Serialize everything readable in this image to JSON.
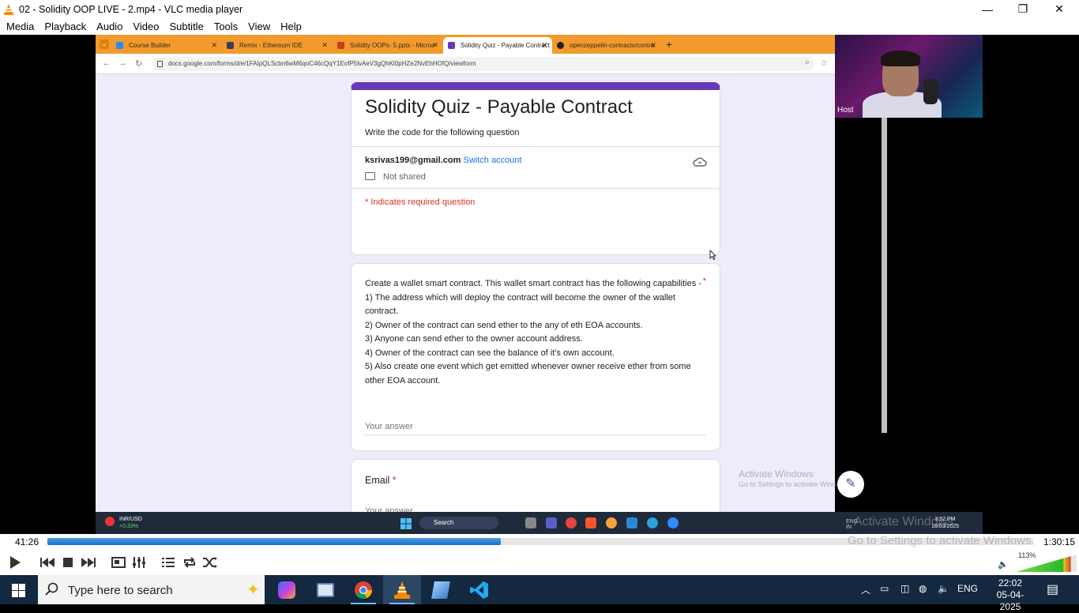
{
  "window": {
    "title": "02 - Solidity OOP LIVE - 2.mp4 - VLC media player",
    "controls": [
      "—",
      "❐",
      "✕"
    ]
  },
  "menu": [
    "Media",
    "Playback",
    "Audio",
    "Video",
    "Subtitle",
    "Tools",
    "View",
    "Help"
  ],
  "browser": {
    "tabs": [
      {
        "label": "Course Builder",
        "color": "#2a8af6"
      },
      {
        "label": "Remix - Ethereum IDE",
        "color": "#3c3c5a"
      },
      {
        "label": "Solidity OOPs- 5.pptx - Micros",
        "color": "#c43e1c"
      },
      {
        "label": "Solidity Quiz - Payable Contract",
        "color": "#673ab7",
        "active": true
      },
      {
        "label": "openzeppelin-contracts/contra",
        "color": "#222222"
      }
    ],
    "url": "docs.google.com/forms/d/e/1FAIpQLScbn6wM6qoC46cQqY1EofP5lvAeV3gQhKl0pHZe2NvEhHOfQ/viewform"
  },
  "form": {
    "title": "Solidity Quiz - Payable Contract",
    "description": "Write the code for the following question",
    "account_email": "ksrivas199@gmail.com",
    "switch_account": "Switch account",
    "not_shared": "Not shared",
    "required_note": "* Indicates required question",
    "q1_lines": [
      "Create a wallet smart contract. This wallet smart contract has the following capabilities -",
      "1) The address which will deploy the contract will become the owner of the wallet contract.",
      "2) Owner of the contract can send ether to the any of eth EOA accounts.",
      "3) Anyone can send ether to the owner account address.",
      "4) Owner of the contract can see the balance of it's own account.",
      "5) Also create one event which get emitted whenever owner receive ether from some other EOA account."
    ],
    "required_star": "*",
    "answer_placeholder": "Your answer",
    "q2_label": "Email",
    "accent_color": "#673ab7"
  },
  "webcam": {
    "label": "Host"
  },
  "watermark": {
    "line1": "Activate Windows",
    "line2": "Go to Settings to activate Windows."
  },
  "recorded_taskbar": {
    "ticker_name": "INR/USD",
    "ticker_change": "+0.33%",
    "search": "Search",
    "lang_top": "ENG",
    "lang_bottom": "IN",
    "time": "3:52 PM",
    "date": "18/03/2025"
  },
  "player": {
    "elapsed": "41:26",
    "total": "1:30:15",
    "progress_fraction": 0.46,
    "seek_watermark": "Go to Settings to activate Windows.",
    "volume_label": "113%",
    "volume_fraction": 1.13
  },
  "taskbar": {
    "search_placeholder": "Type here to search",
    "language": "ENG",
    "time": "22:02",
    "date": "05-04-2025"
  }
}
